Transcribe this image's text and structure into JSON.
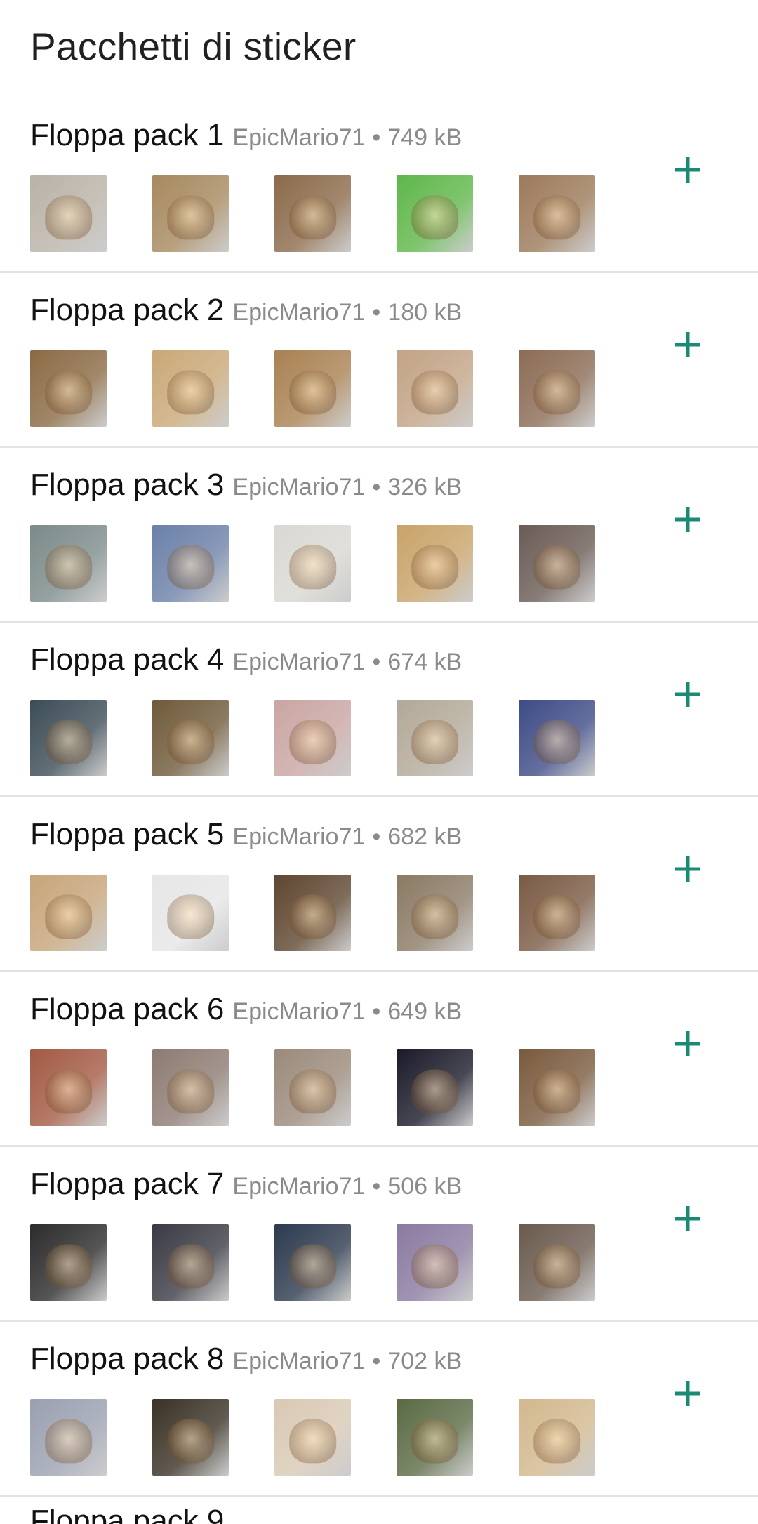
{
  "header": {
    "title": "Pacchetti di sticker"
  },
  "accent_color": "#1b8a75",
  "packs": [
    {
      "name": "Floppa pack 1",
      "author": "EpicMario71",
      "size": "749 kB",
      "stickers": [
        {
          "icon": "sticker-caracal-screaming",
          "bg": "#b9b2a7"
        },
        {
          "icon": "sticker-caracal-face",
          "bg": "#a6895f"
        },
        {
          "icon": "sticker-caracal-open-mouth",
          "bg": "#8b6a4b"
        },
        {
          "icon": "sticker-green-caracal-drawing",
          "bg": "#5fb74a"
        },
        {
          "icon": "sticker-caracal-closeup",
          "bg": "#9c7a5a"
        }
      ]
    },
    {
      "name": "Floppa pack 2",
      "author": "EpicMario71",
      "size": "180 kB",
      "stickers": [
        {
          "icon": "sticker-caracal-cutout",
          "bg": "#8a6a44"
        },
        {
          "icon": "sticker-caracal-lying",
          "bg": "#c9a877"
        },
        {
          "icon": "sticker-caracal-blob",
          "bg": "#a98152"
        },
        {
          "icon": "sticker-caracal-sunglasses",
          "bg": "#c2a385"
        },
        {
          "icon": "sticker-caracal-sitting",
          "bg": "#8b6b55"
        }
      ]
    },
    {
      "name": "Floppa pack 3",
      "author": "EpicMario71",
      "size": "326 kB",
      "stickers": [
        {
          "icon": "sticker-caracal-blue-bg",
          "bg": "#7c8a8a"
        },
        {
          "icon": "sticker-angry-floppa",
          "bg": "#6b80a8"
        },
        {
          "icon": "sticker-caracal-snow",
          "bg": "#d9d8d2"
        },
        {
          "icon": "sticker-caracal-blanket",
          "bg": "#c9a36a"
        },
        {
          "icon": "sticker-caracal-chair",
          "bg": "#6a5b55"
        }
      ]
    },
    {
      "name": "Floppa pack 4",
      "author": "EpicMario71",
      "size": "674 kB",
      "stickers": [
        {
          "icon": "sticker-minecraft-caracal",
          "bg": "#3c4c56"
        },
        {
          "icon": "sticker-caracal-watermelon",
          "bg": "#6f5a3a"
        },
        {
          "icon": "sticker-caracal-toys",
          "bg": "#c9a5a3"
        },
        {
          "icon": "sticker-caracal-microphone",
          "bg": "#b2a898"
        },
        {
          "icon": "sticker-caracal-blue-wall",
          "bg": "#3d4b86"
        }
      ]
    },
    {
      "name": "Floppa pack 5",
      "author": "EpicMario71",
      "size": "682 kB",
      "stickers": [
        {
          "icon": "sticker-caracal-jumping",
          "bg": "#c6a57a"
        },
        {
          "icon": "sticker-manga-panel",
          "bg": "#e6e6e6"
        },
        {
          "icon": "sticker-caracal-bottle",
          "bg": "#5e4630"
        },
        {
          "icon": "sticker-caracal-plaid",
          "bg": "#8a7a64"
        },
        {
          "icon": "sticker-caracal-face-dark",
          "bg": "#7a5a44"
        }
      ]
    },
    {
      "name": "Floppa pack 6",
      "author": "EpicMario71",
      "size": "649 kB",
      "stickers": [
        {
          "icon": "sticker-caracal-meme-red",
          "bg": "#a35a44"
        },
        {
          "icon": "sticker-caracal-meme-uh",
          "bg": "#8c7b72"
        },
        {
          "icon": "sticker-caracal-meme-awake",
          "bg": "#9a8a7a"
        },
        {
          "icon": "sticker-caracal-demotivational",
          "bg": "#1a1a2a"
        },
        {
          "icon": "sticker-caracal-meme-phone",
          "bg": "#7a5a3e"
        }
      ]
    },
    {
      "name": "Floppa pack 7",
      "author": "EpicMario71",
      "size": "506 kB",
      "stickers": [
        {
          "icon": "sticker-caracal-suit",
          "bg": "#2b2b2b"
        },
        {
          "icon": "sticker-caracal-kitten",
          "bg": "#3a3a44"
        },
        {
          "icon": "sticker-caracal-black-cat",
          "bg": "#2c3a4e"
        },
        {
          "icon": "sticker-caracal-lap",
          "bg": "#8a7aa0"
        },
        {
          "icon": "sticker-caracal-bed",
          "bg": "#6a5a4e"
        }
      ]
    },
    {
      "name": "Floppa pack 8",
      "author": "EpicMario71",
      "size": "702 kB",
      "stickers": [
        {
          "icon": "sticker-caracal-astronaut",
          "bg": "#9aa0b0"
        },
        {
          "icon": "sticker-caracal-wait",
          "bg": "#3a3226"
        },
        {
          "icon": "sticker-professor-floppa",
          "bg": "#d8c9b4"
        },
        {
          "icon": "sticker-caracal-yuh",
          "bg": "#5a6a44"
        },
        {
          "icon": "sticker-caracal-closeup-beige",
          "bg": "#d2b88e"
        }
      ]
    }
  ],
  "peek": {
    "name": "Floppa pack 9"
  }
}
